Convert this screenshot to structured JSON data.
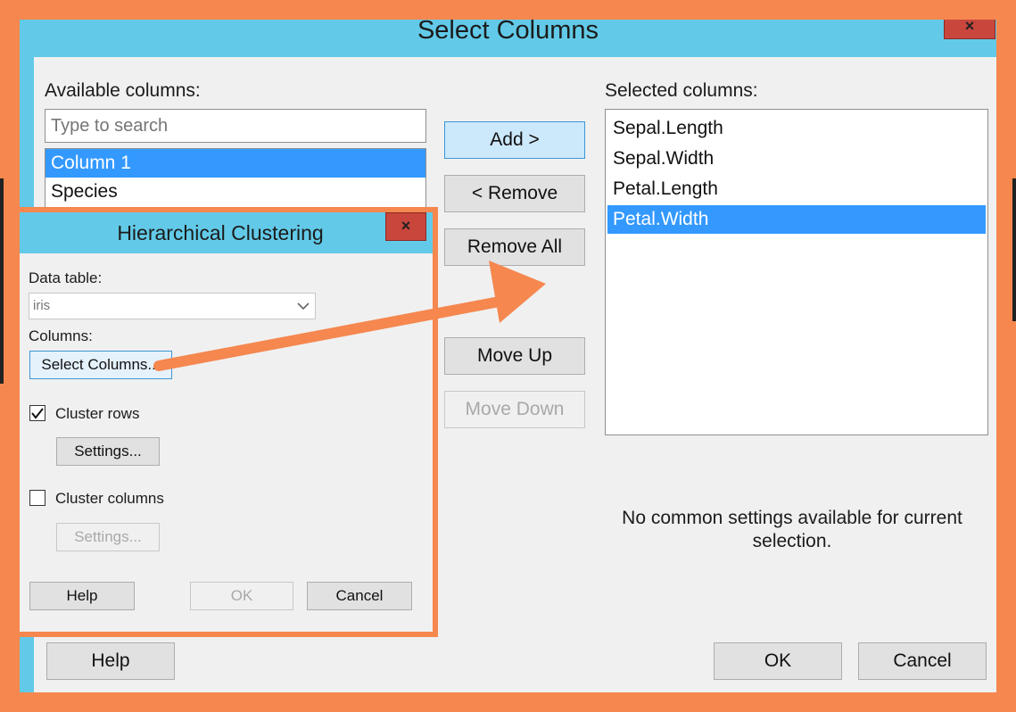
{
  "main_dialog": {
    "title": "Select Columns",
    "close_icon": "×",
    "available_label": "Available columns:",
    "search_placeholder": "Type to search",
    "available_items": [
      "Column 1",
      "Species"
    ],
    "selected_label": "Selected columns:",
    "selected_items": [
      "Sepal.Length",
      "Sepal.Width",
      "Petal.Length",
      "Petal.Width"
    ],
    "buttons": {
      "add": "Add >",
      "remove": "< Remove",
      "remove_all": "Remove All",
      "move_up": "Move Up",
      "move_down": "Move Down",
      "help": "Help",
      "ok": "OK",
      "cancel": "Cancel"
    },
    "settings_message": "No common settings available for current selection."
  },
  "sub_dialog": {
    "title": "Hierarchical Clustering",
    "close_icon": "×",
    "data_table_label": "Data table:",
    "data_table_value": "iris",
    "columns_label": "Columns:",
    "select_columns_button": "Select Columns...",
    "cluster_rows_label": "Cluster rows",
    "cluster_rows_checked": true,
    "cluster_rows_settings": "Settings...",
    "cluster_columns_label": "Cluster columns",
    "cluster_columns_checked": false,
    "cluster_columns_settings": "Settings...",
    "help": "Help",
    "ok": "OK",
    "cancel": "Cancel"
  },
  "colors": {
    "accent_orange": "#f5874f",
    "titlebar_cyan": "#62cae8",
    "selection_blue": "#3399ff",
    "close_red": "#c9463d"
  },
  "icons": [
    "close-icon",
    "chevron-down-icon",
    "checkmark-icon",
    "arrow-annotation"
  ]
}
